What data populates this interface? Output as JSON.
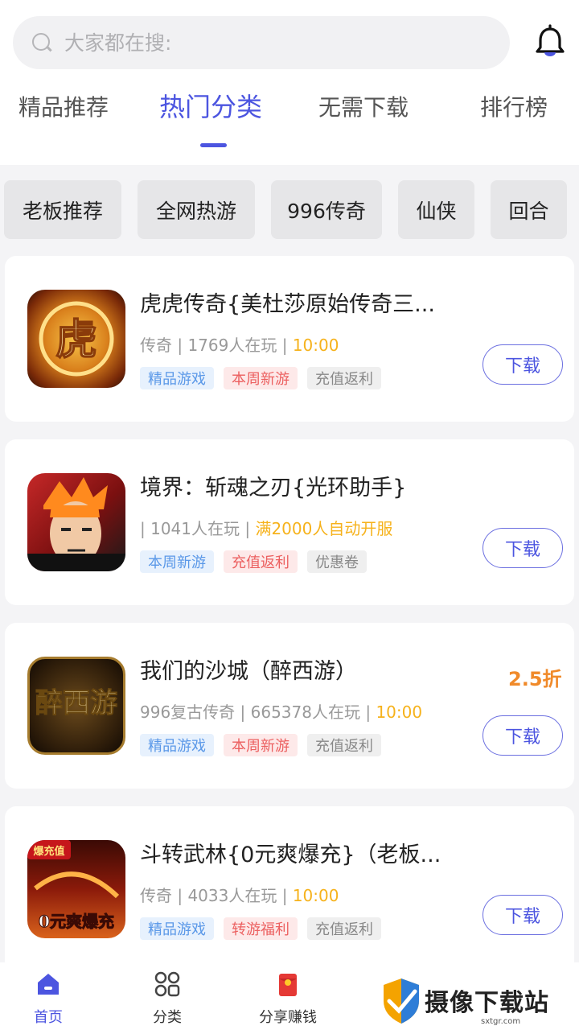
{
  "search": {
    "placeholder": "大家都在搜:"
  },
  "tabs": [
    {
      "label": "精品推荐"
    },
    {
      "label": "热门分类"
    },
    {
      "label": "无需下载"
    },
    {
      "label": "排行榜"
    }
  ],
  "chips": [
    {
      "label": "老板推荐"
    },
    {
      "label": "全网热游"
    },
    {
      "label": "996传奇"
    },
    {
      "label": "仙侠"
    },
    {
      "label": "回合"
    }
  ],
  "games": [
    {
      "title": "虎虎传奇{美杜莎原始传奇三...",
      "meta_prefix": "传奇 | 1769人在玩 | ",
      "meta_highlight": "10:00",
      "tags": [
        "精品游戏",
        "本周新游",
        "充值返利"
      ],
      "button": "下载",
      "icon_text": "虎"
    },
    {
      "title": "境界：斩魂之刃{光环助手}",
      "meta_prefix": "| 1041人在玩 | ",
      "meta_highlight": "满2000人自动开服",
      "tags": [
        "本周新游",
        "充值返利",
        "优惠卷"
      ],
      "button": "下载",
      "icon_text": ""
    },
    {
      "title": "我们的沙城（醉西游）",
      "meta_prefix": "996复古传奇 | 665378人在玩 | ",
      "meta_highlight": "10:00",
      "tags": [
        "精品游戏",
        "本周新游",
        "充值返利"
      ],
      "button": "下载",
      "discount": "2.5折",
      "icon_text": "醉西游"
    },
    {
      "title": "斗转武林{0元爽爆充}（老板...",
      "meta_prefix": "传奇 | 4033人在玩 | ",
      "meta_highlight": "10:00",
      "tags": [
        "精品游戏",
        "转游福利",
        "充值返利"
      ],
      "button": "下载",
      "icon_text": "0元爽爆充",
      "icon_badge": "爆充值"
    }
  ],
  "bottom_nav": [
    {
      "label": "首页",
      "icon": "home-icon"
    },
    {
      "label": "分类",
      "icon": "grid-icon"
    },
    {
      "label": "分享赚钱",
      "icon": "red-envelope-icon"
    }
  ],
  "watermark": {
    "text": "摄像下载站",
    "sub": "sxtgr.com"
  },
  "colors": {
    "accent": "#4c55e0",
    "highlight": "#f6b21c",
    "discount": "#f08a2a"
  }
}
